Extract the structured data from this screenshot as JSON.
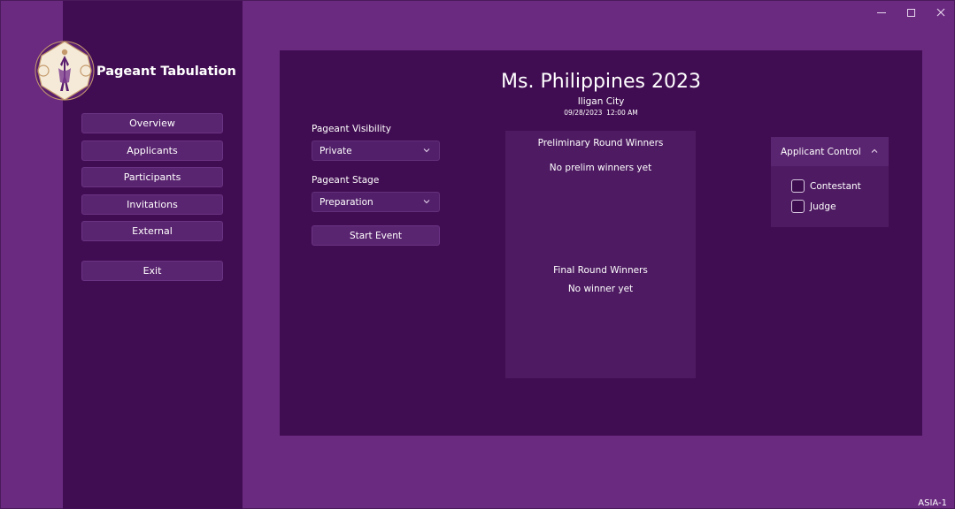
{
  "window": {
    "minimize_icon": "minimize-icon",
    "maximize_icon": "maximize-icon",
    "close_icon": "close-icon"
  },
  "sidebar": {
    "app_title": "Pageant Tabulation",
    "logo_icon": "pageant-logo",
    "nav": [
      {
        "label": "Overview"
      },
      {
        "label": "Applicants"
      },
      {
        "label": "Participants"
      },
      {
        "label": "Invitations"
      },
      {
        "label": "External"
      }
    ],
    "exit_label": "Exit"
  },
  "main": {
    "title": "Ms. Philippines 2023",
    "city": "Iligan City",
    "datetime": "09/28/2023  12:00 AM",
    "visibility": {
      "label": "Pageant Visibility",
      "value": "Private"
    },
    "stage": {
      "label": "Pageant Stage",
      "value": "Preparation"
    },
    "start_button": "Start Event",
    "winners": {
      "prelim_heading": "Preliminary Round Winners",
      "prelim_empty": "No prelim winners yet",
      "final_heading": "Final Round Winners",
      "final_empty": "No winner yet"
    },
    "applicant_control": {
      "header": "Applicant Control",
      "options": [
        {
          "label": "Contestant",
          "checked": false
        },
        {
          "label": "Judge",
          "checked": false
        }
      ]
    }
  },
  "footer": {
    "code": "ASIA-1"
  },
  "colors": {
    "background": "#6a2a80",
    "panel": "#410d52",
    "button": "#5a2570"
  }
}
